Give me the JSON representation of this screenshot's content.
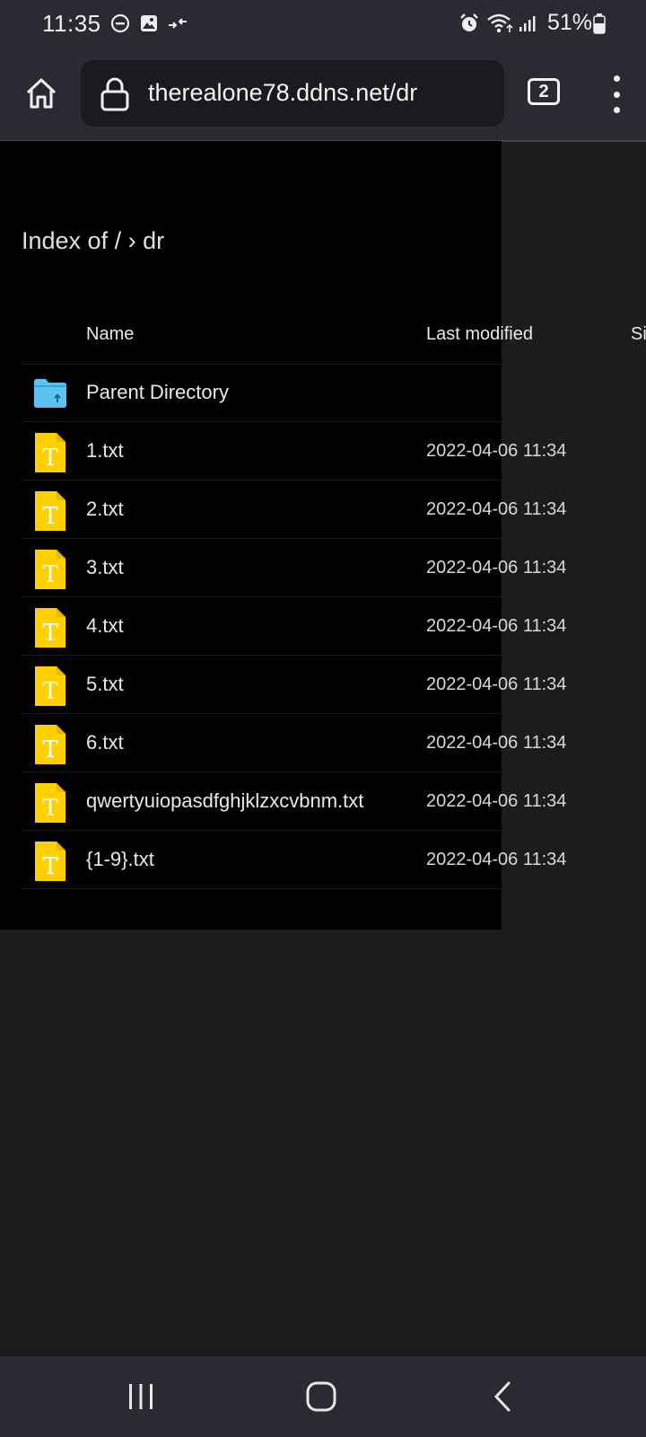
{
  "status_bar": {
    "time": "11:35",
    "battery": "51%",
    "left_icons": [
      "do-not-disturb-icon",
      "image-icon",
      "data-transfer-icon"
    ],
    "right_icons": [
      "alarm-icon",
      "wifi-icon",
      "signal-icon",
      "battery-icon"
    ]
  },
  "browser": {
    "url": "therealone78.ddns.net/dr",
    "tab_count": "2"
  },
  "page": {
    "title": "Index of  / › dr",
    "columns": {
      "name": "Name",
      "last_modified": "Last modified",
      "size": "Si"
    },
    "rows": [
      {
        "name": "Parent Directory",
        "date": "",
        "icon": "folder-up-icon"
      },
      {
        "name": "1.txt",
        "date": "2022-04-06 11:34",
        "icon": "text-file-icon"
      },
      {
        "name": "2.txt",
        "date": "2022-04-06 11:34",
        "icon": "text-file-icon"
      },
      {
        "name": "3.txt",
        "date": "2022-04-06 11:34",
        "icon": "text-file-icon"
      },
      {
        "name": "4.txt",
        "date": "2022-04-06 11:34",
        "icon": "text-file-icon"
      },
      {
        "name": "5.txt",
        "date": "2022-04-06 11:34",
        "icon": "text-file-icon"
      },
      {
        "name": "6.txt",
        "date": "2022-04-06 11:34",
        "icon": "text-file-icon"
      },
      {
        "name": "qwertyuiopasdfghjklzxcvbnm.txt",
        "date": "2022-04-06 11:34",
        "icon": "text-file-icon"
      },
      {
        "name": "{1-9}.txt",
        "date": "2022-04-06 11:34",
        "icon": "text-file-icon"
      }
    ]
  },
  "colors": {
    "chrome": "#2a2a33",
    "page_background": "#000000",
    "file_icon": "#ffd000",
    "folder_icon": "#5bc3f0"
  }
}
